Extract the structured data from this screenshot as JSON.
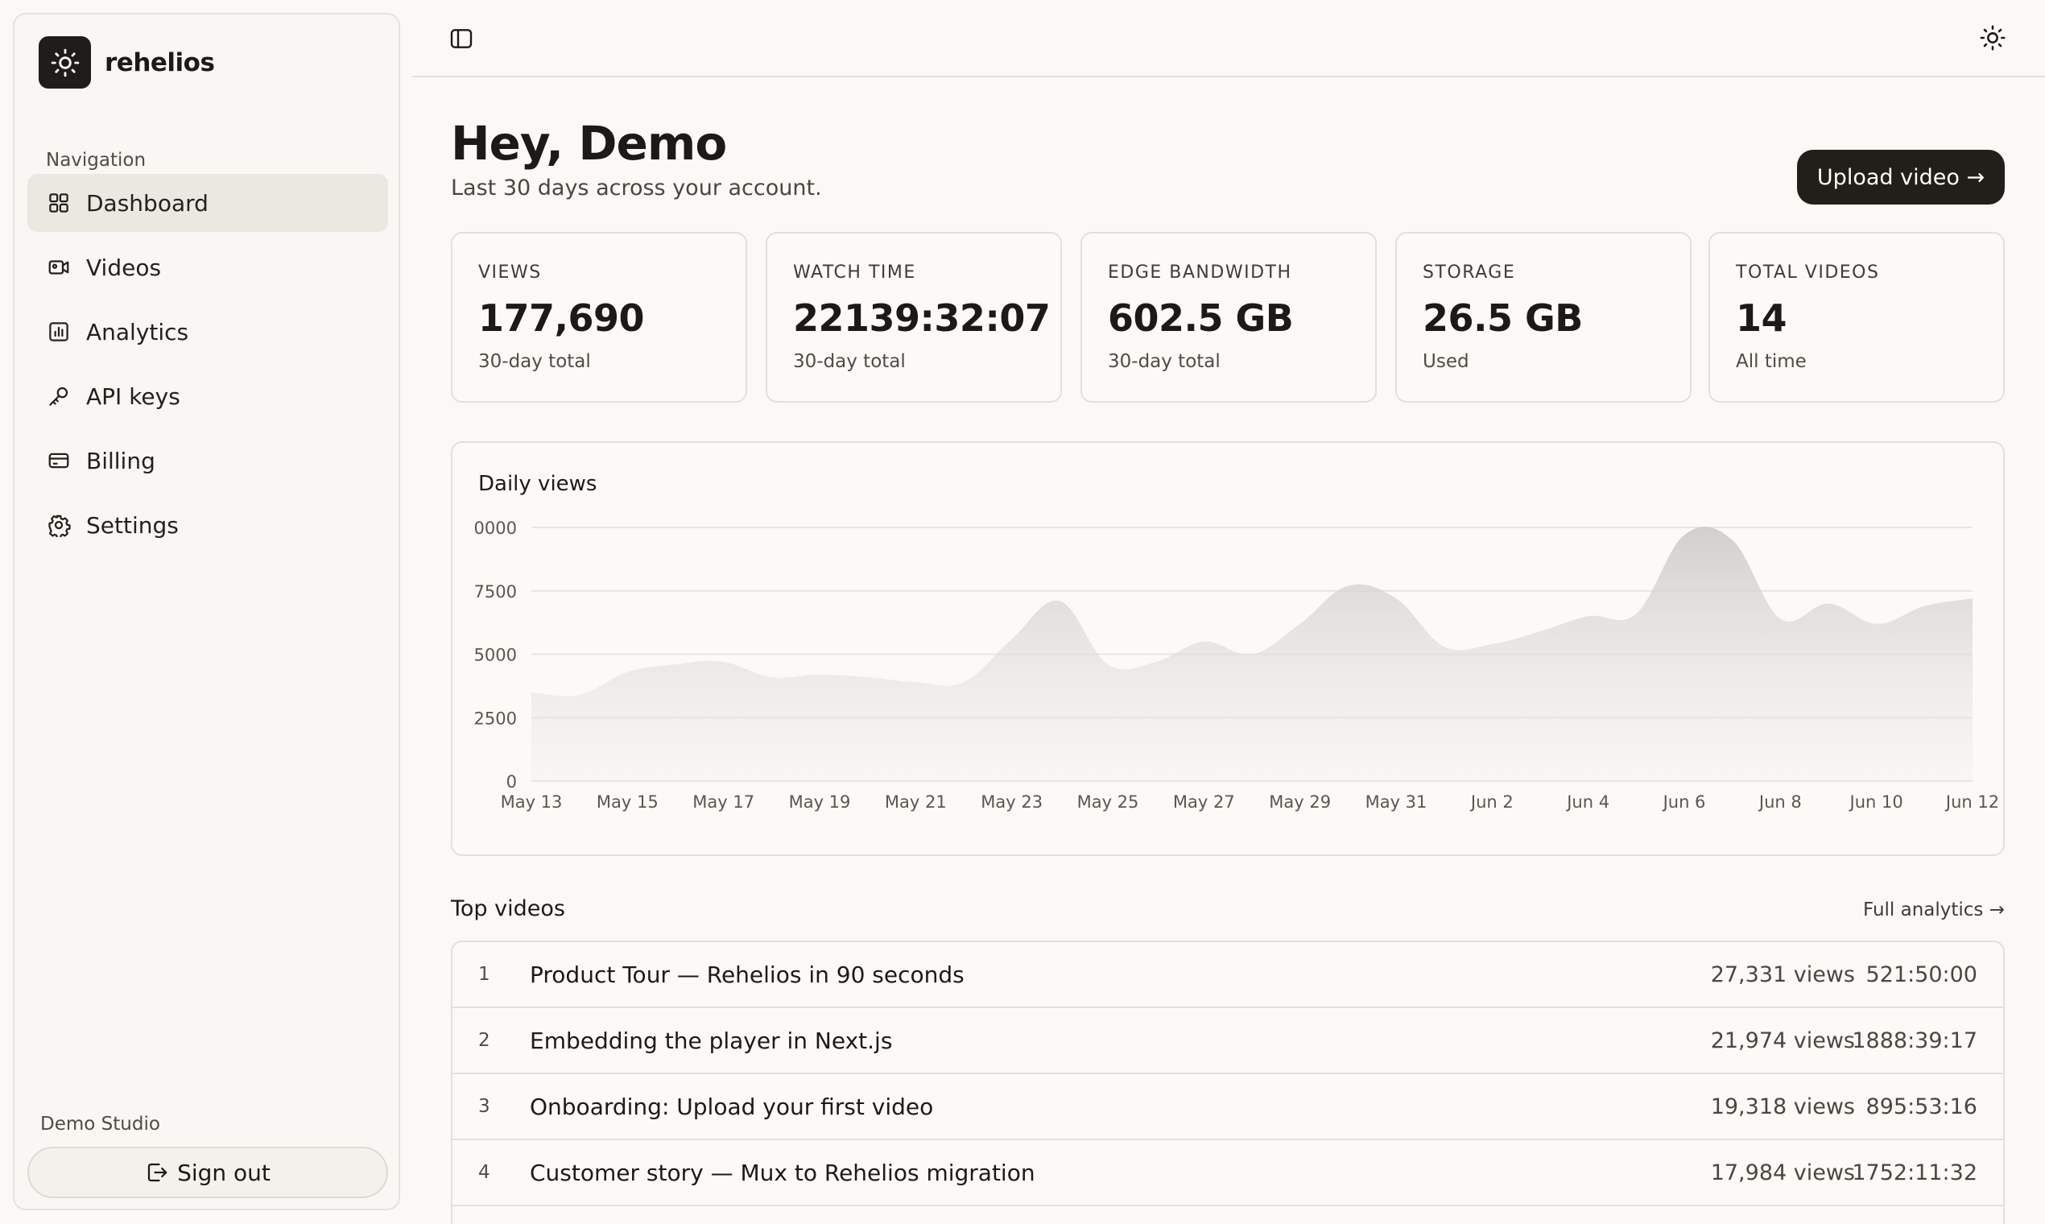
{
  "brand": {
    "name": "rehelios"
  },
  "sidebar": {
    "nav_label": "Navigation",
    "items": [
      {
        "label": "Dashboard",
        "icon": "grid-icon",
        "active": true
      },
      {
        "label": "Videos",
        "icon": "video-icon"
      },
      {
        "label": "Analytics",
        "icon": "bar-chart-icon"
      },
      {
        "label": "API keys",
        "icon": "key-icon"
      },
      {
        "label": "Billing",
        "icon": "card-icon"
      },
      {
        "label": "Settings",
        "icon": "gear-icon"
      }
    ],
    "org_name": "Demo Studio",
    "sign_out": "Sign out"
  },
  "header": {
    "title": "Hey, Demo",
    "subtitle": "Last 30 days across your account.",
    "upload_label": "Upload video →"
  },
  "stats": [
    {
      "label": "VIEWS",
      "value": "177,690",
      "note": "30-day total"
    },
    {
      "label": "WATCH TIME",
      "value": "22139:32:07",
      "note": "30-day total"
    },
    {
      "label": "EDGE BANDWIDTH",
      "value": "602.5 GB",
      "note": "30-day total"
    },
    {
      "label": "STORAGE",
      "value": "26.5 GB",
      "note": "Used"
    },
    {
      "label": "TOTAL VIDEOS",
      "value": "14",
      "note": "All time"
    }
  ],
  "chart_data": {
    "type": "area",
    "title": "Daily views",
    "ylim": [
      0,
      10000
    ],
    "y_ticks": [
      0,
      2500,
      5000,
      7500,
      10000
    ],
    "y_tick_labels": [
      "0",
      "2500",
      "5000",
      "7500",
      "0000"
    ],
    "x_tick_labels": [
      "May 13",
      "May 15",
      "May 17",
      "May 19",
      "May 21",
      "May 23",
      "May 25",
      "May 27",
      "May 29",
      "May 31",
      "Jun 2",
      "Jun 4",
      "Jun 6",
      "Jun 8",
      "Jun 10",
      "Jun 12"
    ],
    "x": [
      "May 13",
      "May 14",
      "May 15",
      "May 16",
      "May 17",
      "May 18",
      "May 19",
      "May 20",
      "May 21",
      "May 22",
      "May 23",
      "May 24",
      "May 25",
      "May 26",
      "May 27",
      "May 28",
      "May 29",
      "May 30",
      "May 31",
      "Jun 1",
      "Jun 2",
      "Jun 3",
      "Jun 4",
      "Jun 5",
      "Jun 6",
      "Jun 7",
      "Jun 8",
      "Jun 9",
      "Jun 10",
      "Jun 11",
      "Jun 12"
    ],
    "values": [
      3500,
      3400,
      4300,
      4600,
      4700,
      4100,
      4200,
      4100,
      3900,
      3900,
      5600,
      7100,
      4600,
      4700,
      5500,
      5000,
      6200,
      7700,
      7200,
      5300,
      5400,
      5900,
      6500,
      6600,
      9700,
      9500,
      6400,
      7000,
      6200,
      6900,
      7200
    ],
    "grid": true,
    "legend": "none"
  },
  "top_videos": {
    "title": "Top videos",
    "link": "Full analytics →",
    "rows": [
      {
        "rank": "1",
        "title": "Product Tour — Rehelios in 90 seconds",
        "views": "27,331 views",
        "duration": "521:50:00"
      },
      {
        "rank": "2",
        "title": "Embedding the player in Next.js",
        "views": "21,974 views",
        "duration": "1888:39:17"
      },
      {
        "rank": "3",
        "title": "Onboarding: Upload your first video",
        "views": "19,318 views",
        "duration": "895:53:16"
      },
      {
        "rank": "4",
        "title": "Customer story — Mux to Rehelios migration",
        "views": "17,984 views",
        "duration": "1752:11:32"
      }
    ]
  }
}
